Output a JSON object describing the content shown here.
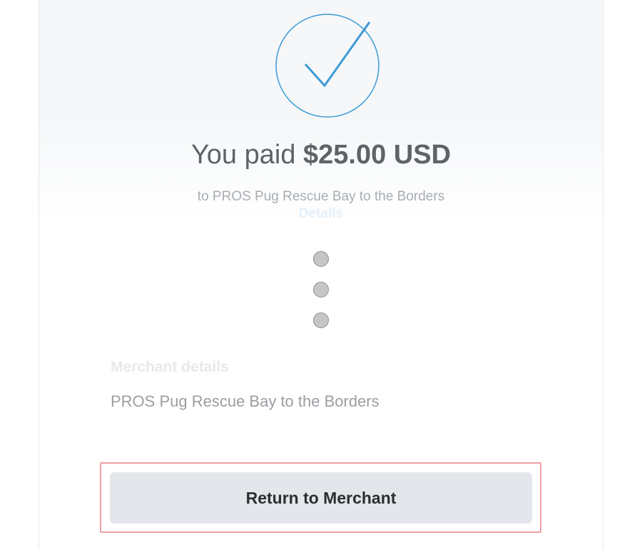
{
  "receipt": {
    "paid_prefix": "You paid",
    "paid_amount": "$25.00 USD",
    "to_line": "to PROS Pug Rescue Bay to the Borders",
    "details_label": "Details"
  },
  "merchant": {
    "heading": "Merchant details",
    "name": "PROS Pug Rescue Bay to the Borders"
  },
  "actions": {
    "return_label": "Return to Merchant"
  },
  "icons": {
    "success": "checkmark-circle-icon",
    "more": "vertical-dots-icon"
  },
  "colors": {
    "check_accent": "#3d9ad6",
    "button_bg": "#e3e7eb",
    "highlight": "#eea0a4"
  }
}
